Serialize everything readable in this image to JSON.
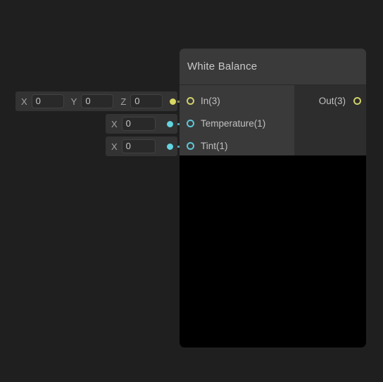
{
  "canvas": {
    "background": "#1f1f1f"
  },
  "colors": {
    "vector_port": "#d8d864",
    "float_port": "#63d4e0",
    "node_body": "#2d2d2d",
    "node_header": "#3a3a3a",
    "widget_row": "#333333",
    "preview": "#000000"
  },
  "widgets": [
    {
      "id": "in-vector3",
      "fields": [
        {
          "axis": "X",
          "value": "0"
        },
        {
          "axis": "Y",
          "value": "0"
        },
        {
          "axis": "Z",
          "value": "0"
        }
      ],
      "dot_color": "vector_port"
    },
    {
      "id": "temperature-float",
      "fields": [
        {
          "axis": "X",
          "value": "0"
        }
      ],
      "dot_color": "float_port"
    },
    {
      "id": "tint-float",
      "fields": [
        {
          "axis": "X",
          "value": "0"
        }
      ],
      "dot_color": "float_port"
    }
  ],
  "node": {
    "title": "White Balance",
    "inputs": [
      {
        "label": "In(3)",
        "type": "vector"
      },
      {
        "label": "Temperature(1)",
        "type": "float"
      },
      {
        "label": "Tint(1)",
        "type": "float"
      }
    ],
    "outputs": [
      {
        "label": "Out(3)",
        "type": "vector"
      }
    ],
    "preview": {
      "color": "#000000"
    }
  }
}
